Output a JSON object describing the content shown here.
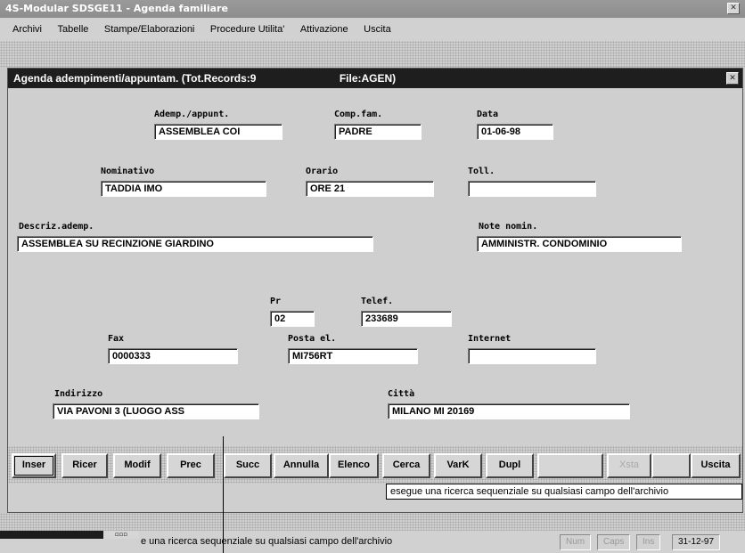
{
  "app": {
    "title": "4S-Modular SDSGE11 - Agenda familiare",
    "close_glyph": "✕"
  },
  "menu": [
    "Archivi",
    "Tabelle",
    "Stampe/Elaborazioni",
    "Procedure Utilita'",
    "Attivazione",
    "Uscita"
  ],
  "window": {
    "title": "Agenda adempimenti/appuntam. (Tot.Records:9",
    "file": "File:AGEN)",
    "close_glyph": "✕"
  },
  "fields": {
    "adempimento": {
      "label": "Ademp./appunt.",
      "value": "ASSEMBLEA COI"
    },
    "comp_fam": {
      "label": "Comp.fam.",
      "value": "PADRE"
    },
    "data": {
      "label": "Data",
      "value": "01-06-98"
    },
    "nominativo": {
      "label": "Nominativo",
      "value": "TADDIA IMO"
    },
    "orario": {
      "label": "Orario",
      "value": "ORE 21"
    },
    "toll": {
      "label": "Toll.",
      "value": ""
    },
    "descrizione": {
      "label": "Descriz.ademp.",
      "value": "ASSEMBLEA SU RECINZIONE GIARDINO"
    },
    "note": {
      "label": "Note nomin.",
      "value": "AMMINISTR. CONDOMINIO"
    },
    "pr": {
      "label": "Pr",
      "value": "02"
    },
    "telefono": {
      "label": "Telef.",
      "value": "233689"
    },
    "fax": {
      "label": "Fax",
      "value": "0000333"
    },
    "posta": {
      "label": "Posta el.",
      "value": "MI756RT"
    },
    "internet": {
      "label": "Internet",
      "value": ""
    },
    "indirizzo": {
      "label": "Indirizzo",
      "value": "VIA PAVONI 3 (LUOGO ASS"
    },
    "citta": {
      "label": "Città",
      "value": "MILANO      MI      20169"
    }
  },
  "buttons": {
    "inser": "Inser",
    "ricer": "Ricer",
    "modif": "Modif",
    "prec": "Prec",
    "succ": "Succ",
    "annulla": "Annulla",
    "elenco": "Elenco",
    "cerca": "Cerca",
    "vark": "VarK",
    "dupl": "Dupl",
    "blank1": "",
    "xsta": "Xsta",
    "blank2": "",
    "uscita": "Uscita"
  },
  "tooltip": "esegue una ricerca sequenziale su qualsiasi campo dell'archivio",
  "statusbar": {
    "message": "e una ricerca sequenziale su qualsiasi campo dell'archivio",
    "num": "Num",
    "caps": "Caps",
    "ins": "Ins",
    "date": "31-12-97"
  }
}
